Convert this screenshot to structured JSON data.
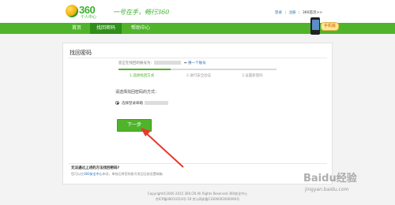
{
  "header": {
    "logo_text": "360",
    "logo_sub": "个人中心",
    "slogan": "一号在手，畅行360",
    "links": {
      "login": "登录",
      "register": "注册",
      "home": "360首页>>"
    },
    "sep": "|"
  },
  "nav": {
    "items": [
      {
        "label": "首页"
      },
      {
        "label": "找回密码"
      },
      {
        "label": "帮助中心"
      }
    ],
    "active_index": 1
  },
  "phone_badge": "手机版",
  "card": {
    "title": "找回密码",
    "account_label": "您正在找回的账号为:",
    "change_account": "换一个账号",
    "steps": [
      {
        "label": "1.选择找回方式"
      },
      {
        "label": "2.进行安全验证"
      },
      {
        "label": "3.设置新密码"
      }
    ],
    "progress": 0.33,
    "prompt": "请选择找回密码的方式：",
    "option": "选择登录邮箱",
    "next_button": "下一步",
    "footer_title": "无法通过上述的方法找回密码?",
    "footer_text_pre": "您可以在",
    "footer_link": "360安全中心",
    "footer_text_post": "申诉，审核后将您的账号发回当前设置邮箱"
  },
  "copyright": "Copyright©2005-2015 360.CN All Rights Reserved 360安全中心",
  "icp": "京ICP备08010314号-19 京公网安备11000002000006号",
  "watermark": {
    "text": "Baidu经验",
    "url": "jingyan.baidu.com"
  },
  "colors": {
    "brand_green": "#4fb42a",
    "nav_active": "#2f8f18",
    "annotation_arrow": "#e53a2e"
  }
}
